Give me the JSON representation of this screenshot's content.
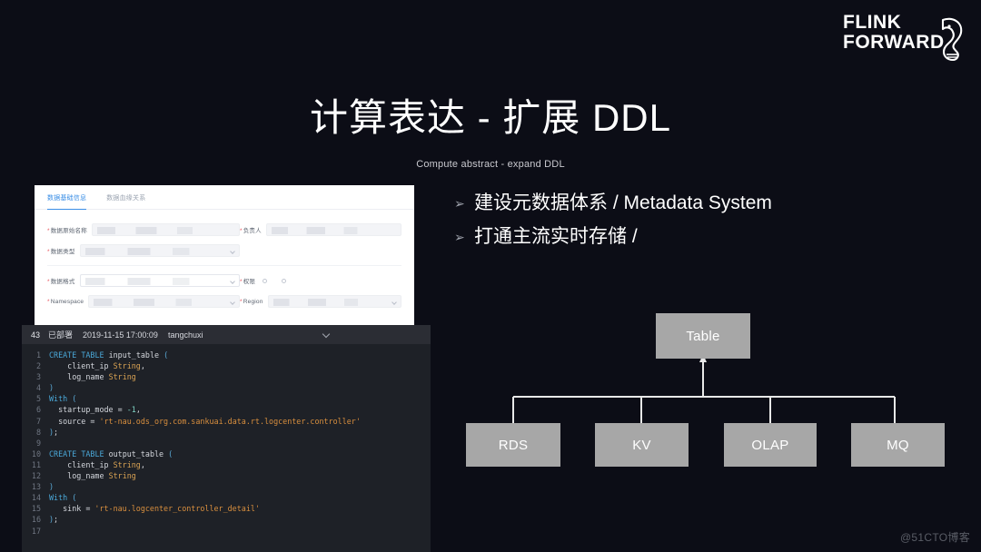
{
  "logo": {
    "line1": "FLINK",
    "line2": "FORWARD",
    "icon": "squirrel-icon"
  },
  "slide": {
    "title": "计算表达 - 扩展 DDL",
    "subtitle": "Compute abstract - expand DDL"
  },
  "bullets": [
    {
      "marker": "➢",
      "text": "建设元数据体系 / Metadata System"
    },
    {
      "marker": "➢",
      "text": "打通主流实时存储 /"
    }
  ],
  "form_screenshot": {
    "tabs": [
      {
        "label": "数据基础信息",
        "active": true
      },
      {
        "label": "数据血缘关系",
        "active": false
      }
    ],
    "fields": [
      {
        "label": "数据原始名称",
        "required": true,
        "type": "text",
        "value": ""
      },
      {
        "label": "负责人",
        "required": true,
        "type": "text",
        "value": ""
      },
      {
        "label": "数据类型",
        "required": true,
        "type": "select",
        "value": ""
      },
      {
        "label": "数据格式",
        "required": true,
        "type": "select",
        "value": ""
      },
      {
        "label": "权限",
        "required": true,
        "type": "radio",
        "value": ""
      },
      {
        "label": "Namespace",
        "required": true,
        "type": "select",
        "value": ""
      },
      {
        "label": "Region",
        "required": true,
        "type": "select",
        "value": ""
      }
    ]
  },
  "code_screenshot": {
    "header": {
      "number": "43",
      "status": "已部署",
      "timestamp": "2019-11-15 17:00:09",
      "user": "tangchuxi",
      "chevron": "chevron-down-icon"
    },
    "lines": [
      {
        "n": "1",
        "tokens": [
          {
            "t": "CREATE",
            "c": "kw"
          },
          {
            "t": " ",
            "c": "cc"
          },
          {
            "t": "TABLE",
            "c": "kw"
          },
          {
            "t": " input_table ",
            "c": "cc"
          },
          {
            "t": "(",
            "c": "pun"
          }
        ]
      },
      {
        "n": "2",
        "tokens": [
          {
            "t": "    client_ip ",
            "c": "cc"
          },
          {
            "t": "String",
            "c": "typ"
          },
          {
            "t": ",",
            "c": "cc"
          }
        ]
      },
      {
        "n": "3",
        "tokens": [
          {
            "t": "    log_name ",
            "c": "cc"
          },
          {
            "t": "String",
            "c": "typ"
          }
        ]
      },
      {
        "n": "4",
        "tokens": [
          {
            "t": ")",
            "c": "pun"
          }
        ]
      },
      {
        "n": "5",
        "tokens": [
          {
            "t": "With",
            "c": "kw"
          },
          {
            "t": " ",
            "c": "cc"
          },
          {
            "t": "(",
            "c": "pun"
          }
        ]
      },
      {
        "n": "6",
        "tokens": [
          {
            "t": "  startup_mode = ",
            "c": "cc"
          },
          {
            "t": "-1",
            "c": "num"
          },
          {
            "t": ",",
            "c": "cc"
          }
        ]
      },
      {
        "n": "7",
        "tokens": [
          {
            "t": "  source = ",
            "c": "cc"
          },
          {
            "t": "'rt-nau.ods_org.com.sankuai.data.rt.logcenter.controller'",
            "c": "str"
          }
        ]
      },
      {
        "n": "8",
        "tokens": [
          {
            "t": ")",
            "c": "pun"
          },
          {
            "t": ";",
            "c": "cc"
          }
        ]
      },
      {
        "n": "9",
        "tokens": [
          {
            "t": "",
            "c": "cc"
          }
        ]
      },
      {
        "n": "10",
        "tokens": [
          {
            "t": "CREATE",
            "c": "kw"
          },
          {
            "t": " ",
            "c": "cc"
          },
          {
            "t": "TABLE",
            "c": "kw"
          },
          {
            "t": " output_table ",
            "c": "cc"
          },
          {
            "t": "(",
            "c": "pun"
          }
        ]
      },
      {
        "n": "11",
        "tokens": [
          {
            "t": "    client_ip ",
            "c": "cc"
          },
          {
            "t": "String",
            "c": "typ"
          },
          {
            "t": ",",
            "c": "cc"
          }
        ]
      },
      {
        "n": "12",
        "tokens": [
          {
            "t": "    log_name ",
            "c": "cc"
          },
          {
            "t": "String",
            "c": "typ"
          }
        ]
      },
      {
        "n": "13",
        "tokens": [
          {
            "t": ")",
            "c": "pun"
          }
        ]
      },
      {
        "n": "14",
        "tokens": [
          {
            "t": "With",
            "c": "kw"
          },
          {
            "t": " ",
            "c": "cc"
          },
          {
            "t": "(",
            "c": "pun"
          }
        ]
      },
      {
        "n": "15",
        "tokens": [
          {
            "t": "   sink = ",
            "c": "cc"
          },
          {
            "t": "'rt-nau.logcenter_controller_detail'",
            "c": "str"
          }
        ]
      },
      {
        "n": "16",
        "tokens": [
          {
            "t": ")",
            "c": "pun"
          },
          {
            "t": ";",
            "c": "cc"
          }
        ]
      },
      {
        "n": "17",
        "tokens": [
          {
            "t": "",
            "c": "cc"
          }
        ]
      }
    ]
  },
  "diagram": {
    "root": {
      "label": "Table"
    },
    "children": [
      {
        "label": "RDS"
      },
      {
        "label": "KV"
      },
      {
        "label": "OLAP"
      },
      {
        "label": "MQ"
      }
    ],
    "box_color": "#a7a7a7",
    "line_color": "#e8e8e8"
  },
  "watermark": "@51CTO博客"
}
